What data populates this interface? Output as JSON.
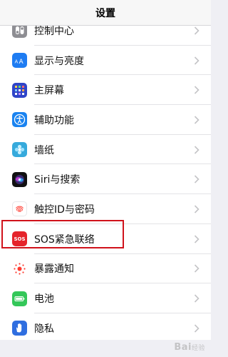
{
  "nav": {
    "title": "设置"
  },
  "rows": [
    {
      "label": "控制中心",
      "icon": "control-center-icon",
      "color": "#8e8e93"
    },
    {
      "label": "显示与亮度",
      "icon": "display-brightness-icon",
      "color": "#1e7cf2"
    },
    {
      "label": "主屏幕",
      "icon": "home-screen-icon",
      "color": "#2f45c8"
    },
    {
      "label": "辅助功能",
      "icon": "accessibility-icon",
      "color": "#1a83f0"
    },
    {
      "label": "墙纸",
      "icon": "wallpaper-icon",
      "color": "#36aadc"
    },
    {
      "label": "Siri与搜索",
      "icon": "siri-icon",
      "color": "#111111"
    },
    {
      "label": "触控ID与密码",
      "icon": "touch-id-icon",
      "color": "#ff3b30"
    },
    {
      "label": "SOS紧急联络",
      "icon": "sos-icon",
      "color": "#e5242b",
      "icon_text": "SOS"
    },
    {
      "label": "暴露通知",
      "icon": "exposure-notification-icon",
      "color": "#ffffff"
    },
    {
      "label": "电池",
      "icon": "battery-icon",
      "color": "#34c759"
    },
    {
      "label": "隐私",
      "icon": "privacy-hand-icon",
      "color": "#2f6ee0"
    }
  ],
  "watermark": {
    "text": "Bai",
    "sub": "经验"
  },
  "colors": {
    "highlight": "#d0121b",
    "background": "#efeff4"
  }
}
